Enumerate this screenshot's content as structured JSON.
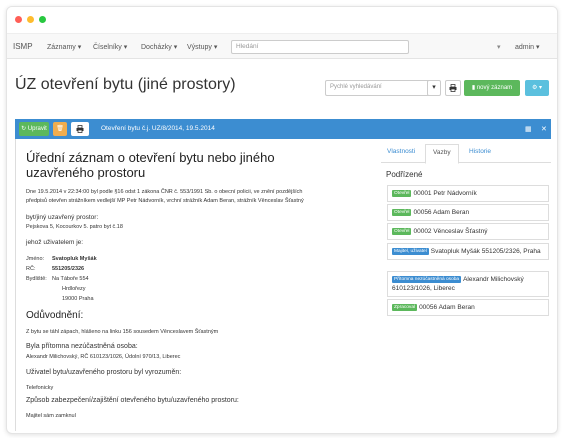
{
  "navbar": {
    "brand": "ISMP",
    "menus": [
      "Záznamy",
      "Číselníky",
      "Docházky",
      "Výstupy"
    ],
    "search_placeholder": "Hledání",
    "user": "admin"
  },
  "page": {
    "title": "ÚZ otevření bytu (jiné prostory)",
    "search_placeholder": "Pychlé vyhledávání",
    "new_button": "nový záznam"
  },
  "panel": {
    "edit_button": "Upravit",
    "reference": "Otevření bytu č.j. UZ/8/2014, 19.5.2014"
  },
  "document": {
    "title": "Úřední záznam o otevření bytu nebo jiného uzavřeného prostoru",
    "intro_1": "Dne 19.5.2014 v 22:34:00 byl podle §16 odst 1 zákona ČNR č. 553/1991 Sb. o obecní policii, ve znění pozdějších",
    "intro_2": "předpisů otevřen strážníkem vedlejší MP Petr Nádvorník, vrchní strážník Adam Beran, strážník Věnceslav Šťastný",
    "section_space": "byt/jiný uzavřený prostor:",
    "space_address": "Pejskova 5, Kocourkov 5. patro byt č.18",
    "section_user": "jehož uživatelem je:",
    "name_label": "Jméno:",
    "name_value": "Svatopluk Myšák",
    "rc_label": "RČ:",
    "rc_value": "551205/2326",
    "residence_label": "Bydliště:",
    "residence_lines": [
      "Na Táboře 554",
      "Hrdlořezy",
      "19000 Praha"
    ],
    "reason_heading": "Odůvodnění:",
    "reason_text": "Z bytu se táhl zápach, hlášeno na linku 156 sousedem Věnceslavem Šťastným",
    "present_heading": "Byla přítomna nezúčastněná osoba:",
    "present_text": "Alexandr Milichovský, RČ 610123/1026, Údolní 970/13, Liberec",
    "notified_heading": "Uživatel bytu/uzavřeného prostoru byl vyrozuměn:",
    "notified_text": "Telefonicky",
    "secured_heading": "Způsob zabezpečení/zajištění otevřeného bytu/uzavřeného prostoru:",
    "secured_text": "Majitel sám zamknul"
  },
  "sidebar": {
    "tabs": [
      "Vlastnosti",
      "Vazby",
      "Historie"
    ],
    "active_tab": "Vazby",
    "heading": "Podřízené",
    "items": [
      {
        "badge": "Otevřel",
        "badge_color": "#5cb85c",
        "text": "00001 Petr Nádvorník"
      },
      {
        "badge": "Otevřel",
        "badge_color": "#5cb85c",
        "text": "00056 Adam Beran"
      },
      {
        "badge": "Otevřel",
        "badge_color": "#5cb85c",
        "text": "00002 Věnceslav Šťastný"
      },
      {
        "badge": "Majitel, uživatel",
        "badge_color": "#3c8dd1",
        "text": "Svatopluk Myšák 551205/2326, Praha"
      },
      {
        "badge": "Přítomna nezúčastněná osoba",
        "badge_color": "#3c8dd1",
        "text": "Alexandr Milichovský 610123/1026, Liberec"
      },
      {
        "badge": "Zpracoval",
        "badge_color": "#5cb85c",
        "text": "00056 Adam Beran"
      }
    ]
  },
  "colors": {
    "primary": "#3c8dd1",
    "success": "#5cb85c",
    "info": "#5bc0de",
    "warning": "#f0ad4e"
  }
}
